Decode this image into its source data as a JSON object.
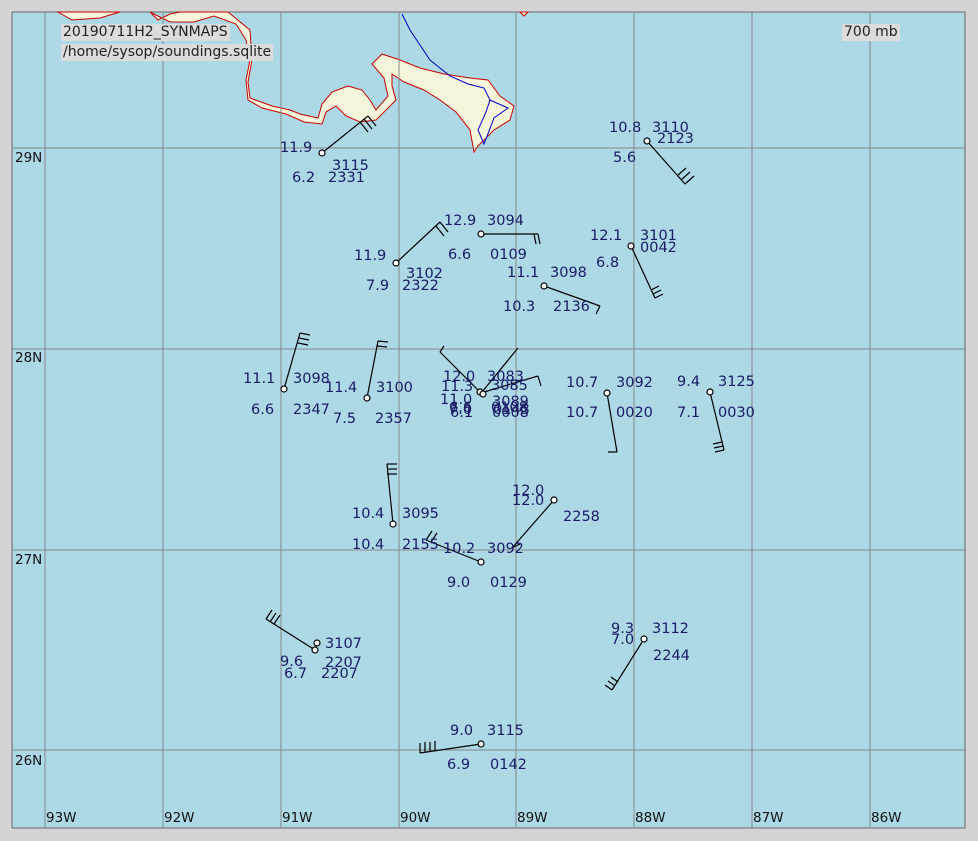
{
  "header": {
    "run_label": "20190711H2_SYNMAPS",
    "db_path": "/home/sysop/soundings.sqlite",
    "level": "700 mb"
  },
  "colors": {
    "water": "#add8e6",
    "land": "#f5f5dc",
    "coast": "#cc0000",
    "river": "#0000cc",
    "grid": "#888888",
    "station_text": "#1a1a66"
  },
  "axes": {
    "lon_labels": [
      "93W",
      "92W",
      "91W",
      "90W",
      "89W",
      "88W",
      "87W",
      "86W"
    ],
    "lat_labels": [
      "29N",
      "28N",
      "27N",
      "26N"
    ]
  },
  "stations": [
    {
      "id": "s1",
      "temp": "11.9",
      "dew": "6.2",
      "height": "3115",
      "wind_code": "2331"
    },
    {
      "id": "s2",
      "temp": "10.8",
      "dew": "5.6",
      "height": "3110",
      "wind_code": "2123"
    },
    {
      "id": "s3",
      "temp": "12.9",
      "dew": "6.6",
      "height": "3094",
      "wind_code": "0109"
    },
    {
      "id": "s4",
      "temp": "11.9",
      "dew": "7.9",
      "height": "3102",
      "wind_code": "2322"
    },
    {
      "id": "s5",
      "temp": "12.1",
      "dew": "6.8",
      "height": "3101",
      "wind_code": "0042"
    },
    {
      "id": "s6",
      "temp": "11.1",
      "dew": "10.3",
      "height": "3098",
      "wind_code": "2136"
    },
    {
      "id": "s7",
      "temp": "11.1",
      "dew": "6.6",
      "height": "3098",
      "wind_code": "2347"
    },
    {
      "id": "s8",
      "temp": "11.4",
      "dew": "7.5",
      "height": "3100",
      "wind_code": "2357"
    },
    {
      "id": "s9",
      "temp": "12.0",
      "dew": "6.6",
      "height": "3083",
      "wind_code": "0108"
    },
    {
      "id": "s10",
      "temp": "11.3",
      "dew": "7.0",
      "height": "3085",
      "wind_code": "0143"
    },
    {
      "id": "s11",
      "temp": "11.0",
      "dew": "6.1",
      "height": "3089",
      "wind_code": "0008"
    },
    {
      "id": "s12",
      "temp": "10.7",
      "dew": "10.7",
      "height": "3092",
      "wind_code": "0020"
    },
    {
      "id": "s13",
      "temp": "9.4",
      "dew": "7.1",
      "height": "3125",
      "wind_code": "0030"
    },
    {
      "id": "s14",
      "temp": "10.4",
      "dew": "10.4",
      "height": "3095",
      "wind_code": "2155"
    },
    {
      "id": "s15",
      "temp": "12.0",
      "dew": "12.0",
      "height": "",
      "wind_code": "2258"
    },
    {
      "id": "s16",
      "temp": "10.2",
      "dew": "9.0",
      "height": "3092",
      "wind_code": "0129"
    },
    {
      "id": "s17",
      "temp": "9.6",
      "dew": "6.7",
      "height": "3107",
      "wind_code": "2207"
    },
    {
      "id": "s17b",
      "temp": "",
      "dew": "",
      "height": "",
      "wind_code": "2207"
    },
    {
      "id": "s18",
      "temp": "9.3",
      "dew": "7.0",
      "height": "3112",
      "wind_code": "2244"
    },
    {
      "id": "s19",
      "temp": "9.0",
      "dew": "6.9",
      "height": "3115",
      "wind_code": "0142"
    }
  ]
}
